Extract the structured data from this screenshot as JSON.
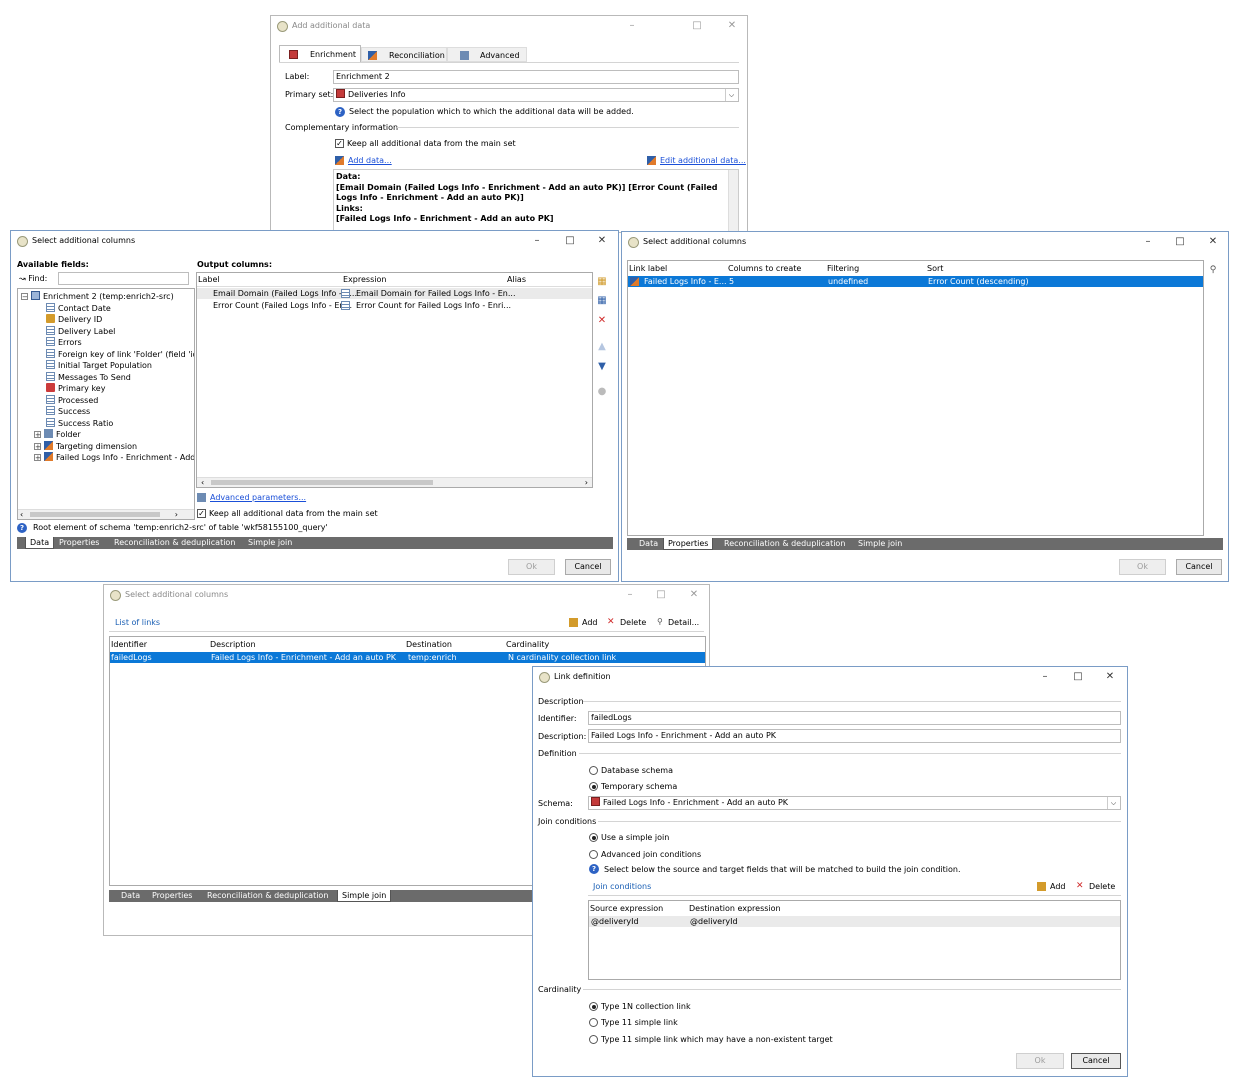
{
  "w1": {
    "title": "Add additional data",
    "tabs": [
      "Enrichment",
      "Reconciliation",
      "Advanced"
    ],
    "label_label": "Label:",
    "label_value": "Enrichment 2",
    "primary_label": "Primary set:",
    "primary_value": "Deliveries Info",
    "primary_hint": "Select the population which to which the additional data will be added.",
    "complementary": "Complementary information",
    "keep_all": "Keep all additional data from the main set",
    "add_data": "Add data...",
    "edit_data": "Edit additional data...",
    "summary_data_label": "Data:",
    "summary_data_value": "[Email Domain (Failed Logs Info - Enrichment - Add an auto PK)]  [Error Count (Failed Logs Info - Enrichment - Add an auto PK)]",
    "summary_links_label": "Links:",
    "summary_links_value": "[Failed Logs Info - Enrichment - Add an auto PK]"
  },
  "w2": {
    "title": "Select additional columns",
    "available_fields": "Available fields:",
    "find_label": "Find:",
    "output_columns": "Output columns:",
    "tree": [
      "Enrichment 2 (temp:enrich2-src)",
      "Contact Date",
      "Delivery ID",
      "Delivery Label",
      "Errors",
      "Foreign key of link 'Folder' (field 'id'",
      "Initial Target Population",
      "Messages To Send",
      "Primary key",
      "Processed",
      "Success",
      "Success Ratio",
      "Folder",
      "Targeting dimension",
      "Failed Logs Info - Enrichment - Add"
    ],
    "col_headers": [
      "Label",
      "Expression",
      "Alias"
    ],
    "rows": [
      {
        "label": "Email Domain (Failed Logs Info - E...",
        "expr": "Email Domain for Failed Logs Info - En..."
      },
      {
        "label": "Error Count (Failed Logs Info - En...",
        "expr": "Error Count for Failed Logs Info - Enri..."
      }
    ],
    "advanced_params": "Advanced parameters...",
    "keep_all": "Keep all additional data from the main set",
    "root_info": "Root element of schema 'temp:enrich2-src' of table 'wkf58155100_query'",
    "tabs": [
      "Data",
      "Properties",
      "Reconciliation & deduplication",
      "Simple join"
    ],
    "ok": "Ok",
    "cancel": "Cancel"
  },
  "w3": {
    "title": "Select additional columns",
    "col_headers": [
      "Link label",
      "Columns to create",
      "Filtering",
      "Sort"
    ],
    "row": {
      "label": "Failed Logs Info - E...",
      "columns": "5",
      "filtering": "undefined",
      "sort": "Error Count (descending)"
    },
    "tabs": [
      "Data",
      "Properties",
      "Reconciliation & deduplication",
      "Simple join"
    ],
    "ok": "Ok",
    "cancel": "Cancel"
  },
  "w4": {
    "title": "Select additional columns",
    "list_title": "List of links",
    "add": "Add",
    "delete": "Delete",
    "detail": "Detail...",
    "col_headers": [
      "Identifier",
      "Description",
      "Destination",
      "Cardinality"
    ],
    "row": {
      "id": "failedLogs",
      "desc": "Failed Logs Info - Enrichment - Add an auto PK",
      "dest": "temp:enrich",
      "card": "N cardinality collection link"
    },
    "tabs": [
      "Data",
      "Properties",
      "Reconciliation & deduplication",
      "Simple join"
    ]
  },
  "w5": {
    "title": "Link definition",
    "description_section": "Description",
    "identifier_label": "Identifier:",
    "identifier_value": "failedLogs",
    "desc_label": "Description:",
    "desc_value": "Failed Logs Info - Enrichment - Add an auto PK",
    "definition_section": "Definition",
    "db_schema": "Database schema",
    "temp_schema": "Temporary schema",
    "schema_label": "Schema:",
    "schema_value": "Failed Logs Info - Enrichment - Add an auto PK",
    "join_section": "Join conditions",
    "simple_join": "Use a simple join",
    "adv_join": "Advanced join conditions",
    "join_hint": "Select below the source and target fields that will be matched to build the join condition.",
    "join_conditions": "Join conditions",
    "add": "Add",
    "delete": "Delete",
    "src_header": "Source expression",
    "dst_header": "Destination expression",
    "src_value": "@deliveryId",
    "dst_value": "@deliveryId",
    "cardinality_section": "Cardinality",
    "card1": "Type 1N collection link",
    "card2": "Type 11 simple link",
    "card3": "Type 11 simple link which may have a non-existent target",
    "ok": "Ok",
    "cancel": "Cancel"
  }
}
